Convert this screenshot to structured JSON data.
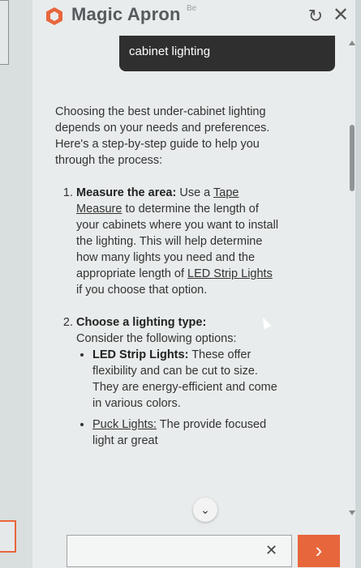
{
  "app": {
    "brand": "Magic Apron",
    "beta_label": "Be"
  },
  "colors": {
    "accent": "#e8663c",
    "bubble": "#2f2f2f"
  },
  "query": "cabinet lighting",
  "answer": {
    "intro": "Choosing the best under-cabinet lighting depends on your needs and preferences. Here's a step-by-step guide to help you through the process:",
    "steps": [
      {
        "number": "1.",
        "title": "Measure the area:",
        "text_a": " Use a ",
        "link_a": "Tape Measure",
        "text_b": " to determine the length of your cabinets where you want to install the lighting. This will help determine how many lights you need and the appropriate length of ",
        "link_b": "LED Strip Lights",
        "text_c": " if you choose that option."
      },
      {
        "number": "2.",
        "title": "Choose a lighting type:",
        "text": "Consider the following options:",
        "options": [
          {
            "title": "LED Strip Lights:",
            "text": " These offer flexibility and can be cut to size. They are energy-efficient and come in various colors."
          },
          {
            "title": "Puck Lights:",
            "text": " The  provide focused light ar    great"
          }
        ]
      }
    ]
  },
  "icons": {
    "logo": "hexagon-logo-icon",
    "refresh": "refresh-icon",
    "close": "close-icon",
    "jump_down": "chevron-down-icon",
    "clear": "clear-x-icon",
    "send": "chevron-right-icon"
  }
}
